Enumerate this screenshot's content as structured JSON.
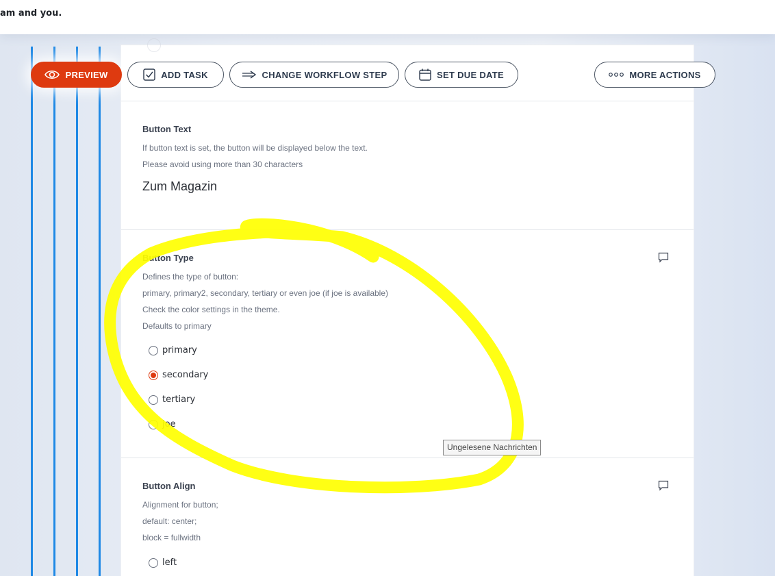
{
  "topbar": {
    "message": "am and you."
  },
  "toolbar": {
    "preview": "PREVIEW",
    "add_task": "ADD TASK",
    "change_workflow_step": "CHANGE WORKFLOW STEP",
    "set_due_date": "SET DUE DATE",
    "more_actions": "MORE ACTIONS"
  },
  "button_text": {
    "label": "Button Text",
    "help_1": "If button text is set, the button will be displayed below the text.",
    "help_2": "Please avoid using more than 30 characters",
    "value": "Zum Magazin"
  },
  "button_type": {
    "label": "Button Type",
    "help_1": "Defines the type of button:",
    "help_2": "primary, primary2, secondary, tertiary or even joe (if joe is available)",
    "help_3": "Check the color settings in the theme.",
    "help_4": "Defaults to primary",
    "options": [
      "primary",
      "secondary",
      "tertiary",
      "joe"
    ],
    "selected": "secondary"
  },
  "button_align": {
    "label": "Button Align",
    "help_1": "Alignment for button;",
    "help_2": "default: center;",
    "help_3": "block = fullwidth",
    "options": [
      "left"
    ]
  },
  "tooltip": "Ungelesene Nachrichten",
  "colors": {
    "accent": "#de3a10",
    "guide_line": "#1e88e5",
    "highlight": "#ffff00"
  },
  "icons": [
    "eye-icon",
    "checkbox-icon",
    "arrow-right-icon",
    "calendar-icon",
    "ellipsis-icon",
    "comment-icon"
  ]
}
